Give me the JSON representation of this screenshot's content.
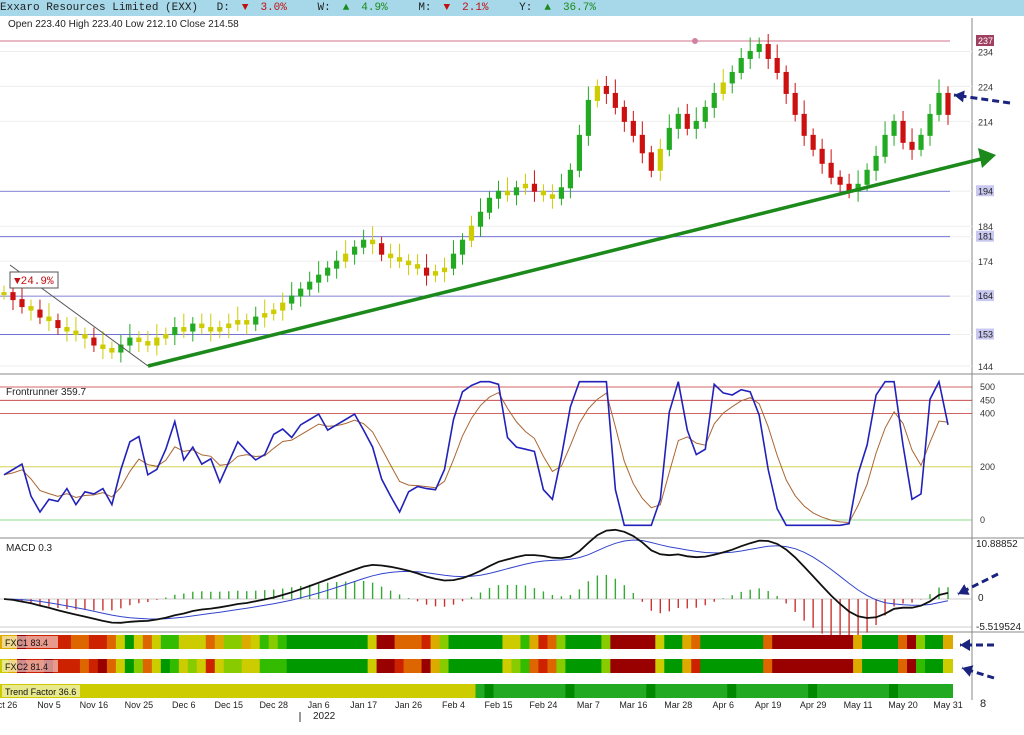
{
  "header": {
    "title": "Exxaro Resources Limited (EXX)",
    "d_label": "D:",
    "d_arrow": "▼",
    "d_value": "3.0%",
    "w_label": "W:",
    "w_arrow": "▲",
    "w_value": "4.9%",
    "m_label": "M:",
    "m_arrow": "▼",
    "m_value": "2.1%",
    "y_label": "Y:",
    "y_arrow": "▲",
    "y_value": "36.7%",
    "ohlc": "Open 223.40  High 223.40  Low 212.10  Close 214.58"
  },
  "colors": {
    "up": "#22aa22",
    "down": "#cc1111",
    "neutral": "#cccc00",
    "trend": "#1b8a1b",
    "rsi": "#2222bb",
    "signal": "#aa6633",
    "arrow": "#1a237e"
  },
  "price_panel": {
    "axis_ticks": [
      "234",
      "224",
      "214",
      "194",
      "184",
      "181",
      "174",
      "164",
      "153",
      "144"
    ],
    "level_labels": [
      "237",
      "194",
      "181",
      "164",
      "153"
    ],
    "change_label": "▼24.9%"
  },
  "osc_panel": {
    "label": "Frontrunner 359.7",
    "axis_ticks": [
      "500",
      "450",
      "400",
      "200",
      "0"
    ]
  },
  "macd_panel": {
    "label": "MACD 0.3",
    "top_label": "10.88852",
    "zero_label": "0",
    "bottom_label": "-5.519524"
  },
  "bands": [
    {
      "label": "FXC1 83.4"
    },
    {
      "label": "FXC2 81.4"
    },
    {
      "label": "Trend Factor 36.6"
    }
  ],
  "x_axis": {
    "ticks": [
      "Oct 26",
      "Nov 5",
      "Nov 16",
      "Nov 25",
      "Dec 6",
      "Dec 15",
      "Dec 28",
      "Jan 6",
      "Jan 17",
      "Jan 26",
      "Feb 4",
      "Feb 15",
      "Feb 24",
      "Mar 7",
      "Mar 16",
      "Mar 28",
      "Apr 6",
      "Apr 19",
      "Apr 29",
      "May 11",
      "May 20",
      "May 31"
    ],
    "year": "2022",
    "corner": "8"
  },
  "chart_data": {
    "type": "candlestick",
    "title": "Exxaro Resources Limited (EXX)",
    "ylim": [
      144,
      237
    ],
    "horizontal_levels": [
      237,
      194,
      181,
      164,
      153
    ],
    "trendline": {
      "from": {
        "date": "Nov 26",
        "value": 144
      },
      "to": {
        "date": "Jun 3",
        "value": 200
      }
    },
    "close_series": [
      165,
      163,
      161,
      160,
      158,
      157,
      155,
      154,
      153,
      152,
      150,
      149,
      148,
      150,
      152,
      151,
      150,
      152,
      153,
      155,
      154,
      156,
      155,
      154,
      155,
      156,
      157,
      156,
      158,
      159,
      160,
      162,
      164,
      166,
      168,
      170,
      172,
      174,
      176,
      178,
      180,
      179,
      176,
      175,
      174,
      173,
      172,
      170,
      171,
      172,
      176,
      180,
      184,
      188,
      192,
      194,
      193,
      195,
      196,
      194,
      193,
      192,
      195,
      200,
      210,
      220,
      224,
      222,
      218,
      214,
      210,
      205,
      200,
      206,
      212,
      216,
      212,
      214,
      218,
      222,
      225,
      228,
      232,
      234,
      236,
      232,
      228,
      222,
      216,
      210,
      206,
      202,
      198,
      196,
      194,
      196,
      200,
      204,
      210,
      214,
      208,
      206,
      210,
      216,
      222,
      216
    ]
  }
}
